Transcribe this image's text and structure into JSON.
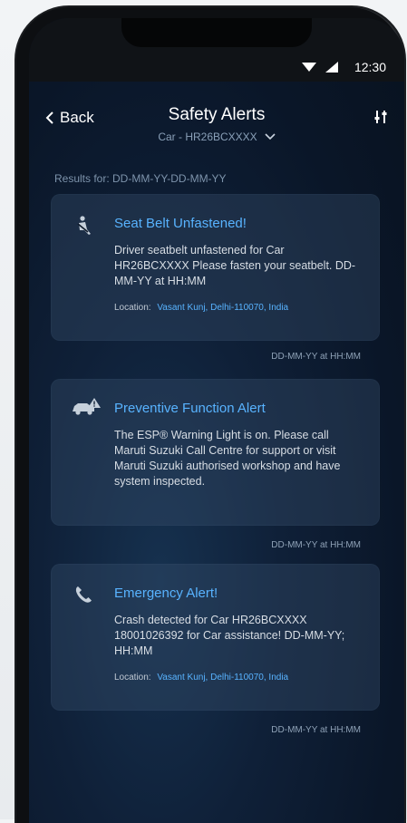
{
  "status": {
    "time": "12:30"
  },
  "header": {
    "back_label": "Back",
    "title": "Safety Alerts",
    "subtitle": "Car - HR26BCXXXX"
  },
  "results_label": "Results for: DD-MM-YY-DD-MM-YY",
  "alerts": [
    {
      "title": "Seat Belt Unfastened!",
      "body": "Driver seatbelt unfastened for Car HR26BCXXXX Please fasten your seatbelt. DD-MM-YY at HH:MM",
      "location_label": "Location:",
      "location_value": "Vasant Kunj, Delhi-110070, India",
      "timestamp": "DD-MM-YY at HH:MM",
      "icon": "seatbelt-icon"
    },
    {
      "title": "Preventive Function Alert",
      "body": "The ESP® Warning Light is on. Please call Maruti Suzuki Call Centre for support or visit Maruti Suzuki authorised workshop and have system inspected.",
      "timestamp": "DD-MM-YY at HH:MM",
      "icon": "car-warning-icon"
    },
    {
      "title": "Emergency Alert!",
      "body": "Crash detected for Car HR26BCXXXX 18001026392 for Car assistance! DD-MM-YY; HH:MM",
      "location_label": "Location:",
      "location_value": "Vasant Kunj, Delhi-110070, India",
      "timestamp": "DD-MM-YY at HH:MM",
      "icon": "phone-icon"
    }
  ],
  "colors": {
    "accent": "#58b3ff",
    "background": "#0a1628"
  }
}
